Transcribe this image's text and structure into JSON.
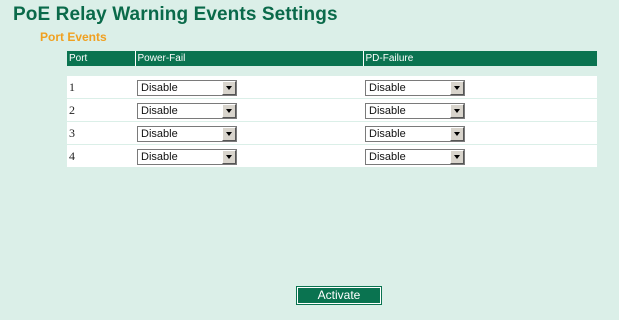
{
  "page": {
    "title": "PoE Relay Warning Events Settings",
    "section_title": "Port Events"
  },
  "table": {
    "headers": [
      "Port",
      "Power-Fail",
      "PD-Failure"
    ],
    "rows": [
      {
        "port": "1",
        "power_fail": "Disable",
        "pd_failure": "Disable"
      },
      {
        "port": "2",
        "power_fail": "Disable",
        "pd_failure": "Disable"
      },
      {
        "port": "3",
        "power_fail": "Disable",
        "pd_failure": "Disable"
      },
      {
        "port": "4",
        "power_fail": "Disable",
        "pd_failure": "Disable"
      }
    ]
  },
  "actions": {
    "activate_label": "Activate"
  },
  "colors": {
    "background": "#dbefe8",
    "title": "#0a6a4a",
    "section_title": "#f0a020",
    "header_bg": "#0a7350"
  }
}
